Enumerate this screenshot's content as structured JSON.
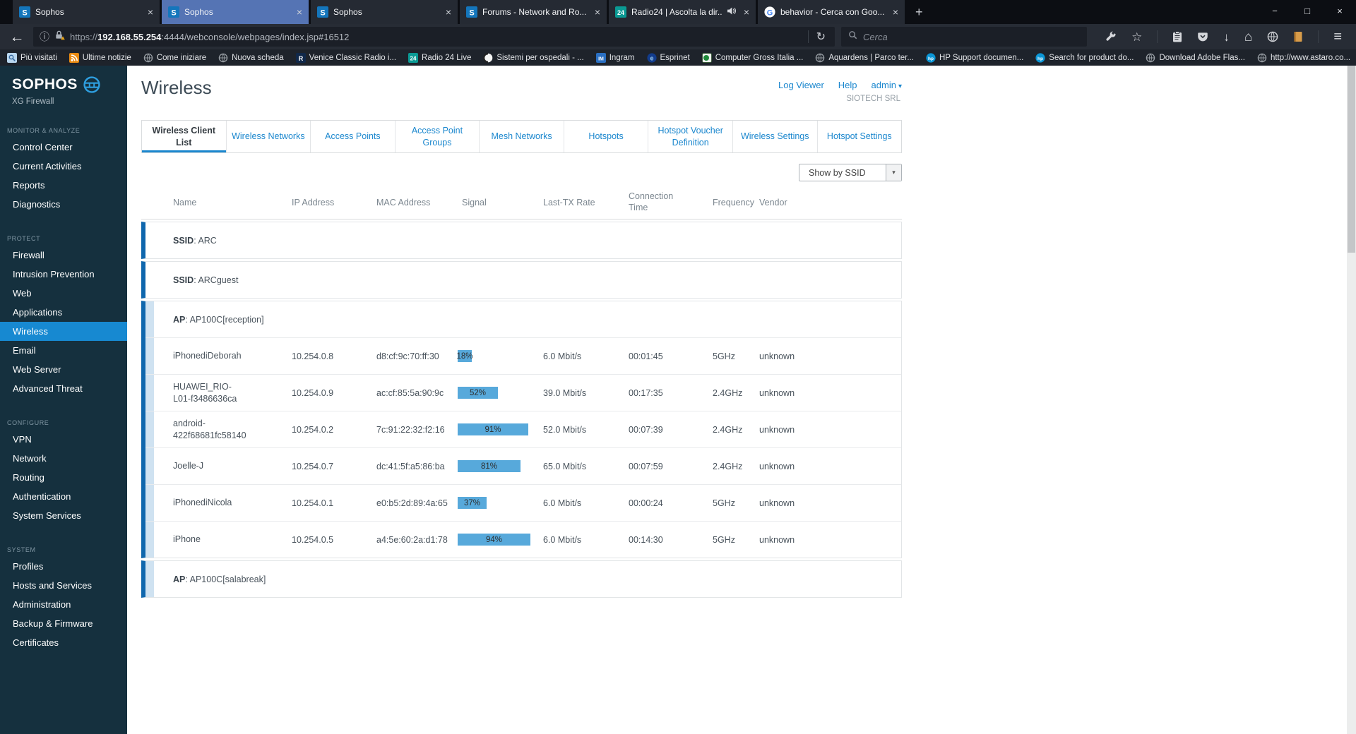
{
  "browser": {
    "tabs": [
      {
        "title": "Sophos",
        "favicon": "sophos",
        "active": false
      },
      {
        "title": "Sophos",
        "favicon": "sophos",
        "active": true
      },
      {
        "title": "Sophos",
        "favicon": "sophos",
        "active": false
      },
      {
        "title": "Forums - Network and Ro...",
        "favicon": "sophos",
        "active": false
      },
      {
        "title": "Radio24 | Ascolta la dir...",
        "favicon": "radio24",
        "active": false,
        "audio": true
      },
      {
        "title": "behavior - Cerca con Goo...",
        "favicon": "google",
        "active": false
      }
    ],
    "url": {
      "protocol": "https://",
      "domain": "192.168.55.254",
      "rest": ":4444/webconsole/webpages/index.jsp#16512"
    },
    "search_placeholder": "Cerca",
    "bookmarks": [
      {
        "label": "Più visitati",
        "icon": "search"
      },
      {
        "label": "Ultime notizie",
        "icon": "rss"
      },
      {
        "label": "Come iniziare",
        "icon": "globe"
      },
      {
        "label": "Nuova scheda",
        "icon": "globe"
      },
      {
        "label": "Venice Classic Radio i...",
        "icon": "venice"
      },
      {
        "label": "Radio 24 Live",
        "icon": "radio24"
      },
      {
        "label": "Sistemi per ospedali - ...",
        "icon": "circle-dark"
      },
      {
        "label": "Ingram",
        "icon": "ingram"
      },
      {
        "label": "Esprinet",
        "icon": "esprinet"
      },
      {
        "label": "Computer Gross Italia ...",
        "icon": "computergross"
      },
      {
        "label": "Aquardens | Parco ter...",
        "icon": "globe"
      },
      {
        "label": "HP Support documen...",
        "icon": "hp"
      },
      {
        "label": "Search for product do...",
        "icon": "hp"
      },
      {
        "label": "Download Adobe Flas...",
        "icon": "globe"
      },
      {
        "label": "http://www.astaro.co...",
        "icon": "globe"
      }
    ],
    "icons": {
      "back": "←",
      "info": "ⓘ",
      "reload": "↻",
      "star": "☆",
      "download": "↓",
      "home": "⌂",
      "menu": "≡",
      "minimize": "−",
      "maximize": "□",
      "close": "×",
      "tab_close": "×",
      "new_tab": "+",
      "overflow": "»",
      "dropdown": "▾",
      "caret": "▾"
    }
  },
  "sidebar": {
    "logo": "SOPHOS",
    "logo_sub": "XG Firewall",
    "sections": [
      {
        "title": "MONITOR & ANALYZE",
        "items": [
          "Control Center",
          "Current Activities",
          "Reports",
          "Diagnostics"
        ]
      },
      {
        "title": "PROTECT",
        "selected": "Wireless",
        "items": [
          "Firewall",
          "Intrusion Prevention",
          "Web",
          "Applications",
          "Wireless",
          "Email",
          "Web Server",
          "Advanced Threat"
        ]
      },
      {
        "title": "CONFIGURE",
        "items": [
          "VPN",
          "Network",
          "Routing",
          "Authentication",
          "System Services"
        ]
      },
      {
        "title": "SYSTEM",
        "items": [
          "Profiles",
          "Hosts and Services",
          "Administration",
          "Backup & Firmware",
          "Certificates"
        ]
      }
    ]
  },
  "header": {
    "title": "Wireless",
    "links": [
      "Log Viewer",
      "Help"
    ],
    "user": "admin",
    "company": "SIOTECH SRL"
  },
  "page_tabs": {
    "active": "Wireless Client List",
    "items": [
      "Wireless Client List",
      "Wireless Networks",
      "Access Points",
      "Access Point Groups",
      "Mesh Networks",
      "Hotspots",
      "Hotspot Voucher Definition",
      "Wireless Settings",
      "Hotspot Settings"
    ]
  },
  "toolbar": {
    "show_by": "Show by SSID"
  },
  "table": {
    "columns": [
      "Name",
      "IP Address",
      "MAC Address",
      "Signal",
      "Last-TX Rate",
      "Connection Time",
      "Frequency",
      "Vendor"
    ],
    "groups": [
      {
        "type": "ssid",
        "label": "SSID",
        "value": "ARC",
        "clients": []
      },
      {
        "type": "ssid",
        "label": "SSID",
        "value": "ARCguest",
        "clients": []
      },
      {
        "type": "ap",
        "label": "AP",
        "value": "AP100C[reception]",
        "clients": [
          {
            "name": "iPhonediDeborah",
            "ip": "10.254.0.8",
            "mac": "d8:cf:9c:70:ff:30",
            "signal_pct": 18,
            "signal_label": "18%",
            "rate": "6.0 Mbit/s",
            "time": "00:01:45",
            "freq": "5GHz",
            "vendor": "unknown"
          },
          {
            "name": "HUAWEI_RIO-L01-f3486636ca",
            "ip": "10.254.0.9",
            "mac": "ac:cf:85:5a:90:9c",
            "signal_pct": 52,
            "signal_label": "52%",
            "rate": "39.0 Mbit/s",
            "time": "00:17:35",
            "freq": "2.4GHz",
            "vendor": "unknown"
          },
          {
            "name": "android-422f68681fc58140",
            "ip": "10.254.0.2",
            "mac": "7c:91:22:32:f2:16",
            "signal_pct": 91,
            "signal_label": "91%",
            "rate": "52.0 Mbit/s",
            "time": "00:07:39",
            "freq": "2.4GHz",
            "vendor": "unknown"
          },
          {
            "name": "Joelle-J",
            "ip": "10.254.0.7",
            "mac": "dc:41:5f:a5:86:ba",
            "signal_pct": 81,
            "signal_label": "81%",
            "rate": "65.0 Mbit/s",
            "time": "00:07:59",
            "freq": "2.4GHz",
            "vendor": "unknown"
          },
          {
            "name": "iPhonediNicola",
            "ip": "10.254.0.1",
            "mac": "e0:b5:2d:89:4a:65",
            "signal_pct": 37,
            "signal_label": "37%",
            "rate": "6.0 Mbit/s",
            "time": "00:00:24",
            "freq": "5GHz",
            "vendor": "unknown"
          },
          {
            "name": "iPhone",
            "ip": "10.254.0.5",
            "mac": "a4:5e:60:2a:d1:78",
            "signal_pct": 94,
            "signal_label": "94%",
            "rate": "6.0 Mbit/s",
            "time": "00:14:30",
            "freq": "5GHz",
            "vendor": "unknown"
          }
        ]
      },
      {
        "type": "ap",
        "label": "AP",
        "value": "AP100C[salabreak]",
        "clients": []
      }
    ]
  },
  "colors": {
    "accent": "#1789d1",
    "signal_bar": "#57a9db",
    "group_bar_dark": "#0f67ad",
    "group_bar_light": "#cfe2f1",
    "active_tab": "#5574b4"
  }
}
